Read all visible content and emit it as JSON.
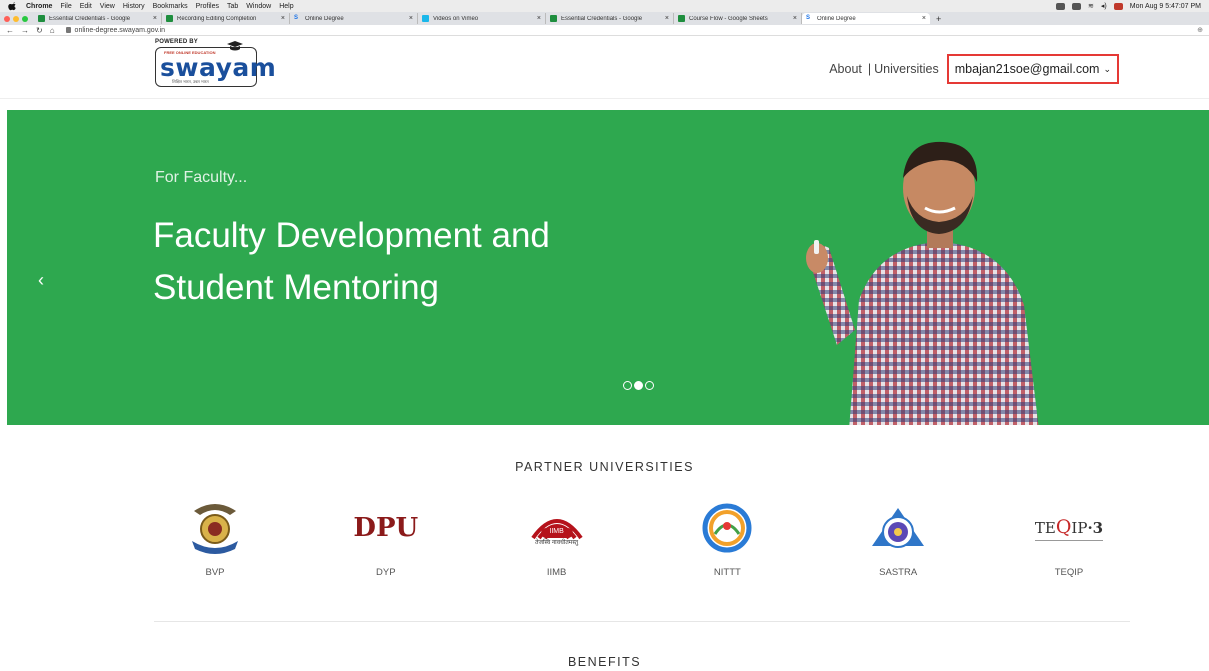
{
  "menubar": {
    "app": "Chrome",
    "items": [
      "File",
      "Edit",
      "View",
      "History",
      "Bookmarks",
      "Profiles",
      "Tab",
      "Window",
      "Help"
    ],
    "clock": "Mon Aug 9  5:47:07 PM"
  },
  "tabs": [
    {
      "title": "Essential Credentials - Google",
      "color": "#1e8e3e"
    },
    {
      "title": "Recording Editing Completion",
      "color": "#1e8e3e"
    },
    {
      "title": "Online Degree",
      "color": "#1a73e8",
      "letter": "S"
    },
    {
      "title": "Videos on Vimeo",
      "color": "#1ab7ea"
    },
    {
      "title": "Essential Credentials - Google",
      "color": "#1e8e3e"
    },
    {
      "title": "Course Flow - Google Sheets",
      "color": "#1e8e3e"
    },
    {
      "title": "Online Degree",
      "color": "#1a73e8",
      "letter": "S",
      "active": true
    }
  ],
  "address": {
    "url": "online-degree.swayam.gov.in"
  },
  "header": {
    "powered_by": "POWERED BY",
    "logo_top": "FREE ONLINE EDUCATION",
    "logo_word": "swayam",
    "logo_tag": "शिक्षित भारत, उन्नत भारत",
    "nav_about": "About",
    "nav_sep": "|",
    "nav_universities": "Universities",
    "user_email": "mbajan21soe@gmail.com",
    "user_chevron": "⌄"
  },
  "hero": {
    "kicker": "For Faculty...",
    "line1": "Faculty Development and",
    "line2": "Student Mentoring",
    "prev": "‹",
    "slides": 3,
    "active_slide": 2
  },
  "partners": {
    "title": "PARTNER UNIVERSITIES",
    "items": [
      {
        "name": "BVP",
        "logo": "bvp-emblem-icon"
      },
      {
        "name": "DYP",
        "logo": "dpu-logo",
        "mark": "DPU"
      },
      {
        "name": "IIMB",
        "logo": "iimb-logo",
        "mark": "IIMB",
        "sub": "तेजस्वि नावधीतमस्तु"
      },
      {
        "name": "NITTT",
        "logo": "nittt-logo"
      },
      {
        "name": "SASTRA",
        "logo": "sastra-logo"
      },
      {
        "name": "TEQIP",
        "logo": "teqip-logo",
        "mark_a": "TE",
        "mark_b": "Q",
        "mark_c": "IP",
        "mark_d": "·3"
      }
    ]
  },
  "benefits": {
    "title": "BENEFITS"
  }
}
